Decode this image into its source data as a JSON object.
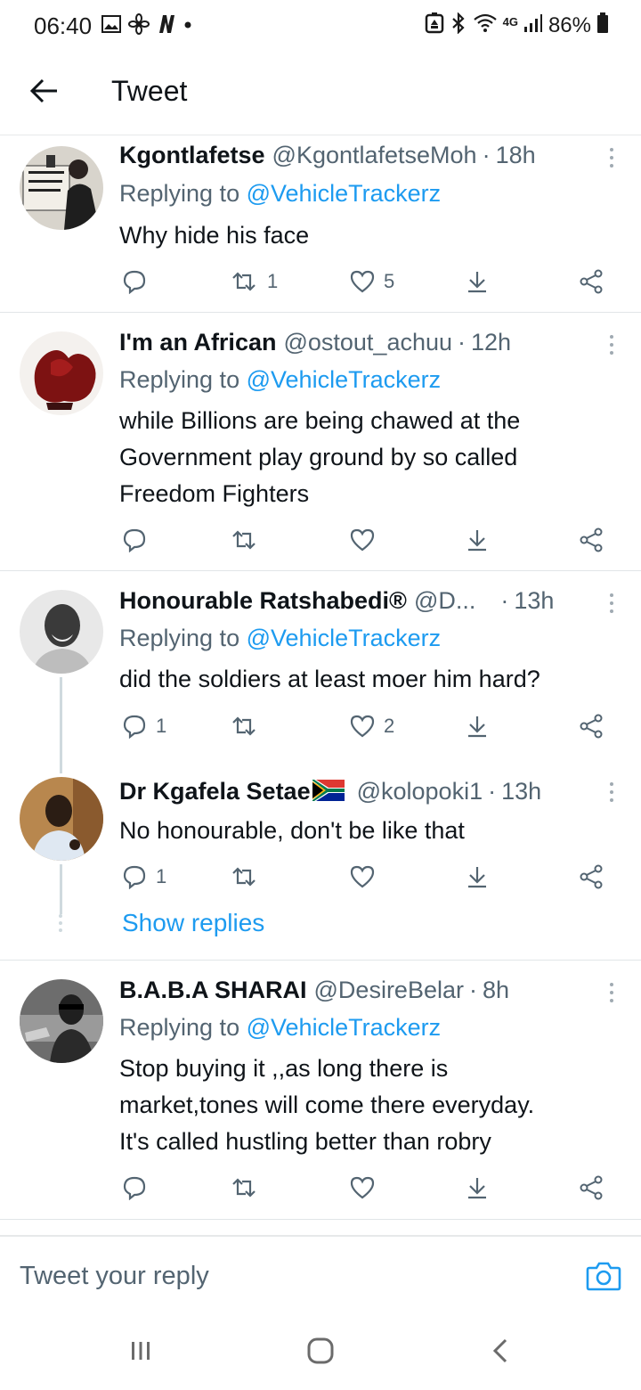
{
  "status_bar": {
    "time": "06:40",
    "battery": "86%",
    "network": "4G",
    "left_icons": [
      "image-icon",
      "fan-icon",
      "netflix-n-icon",
      "dot-icon"
    ],
    "right_icons": [
      "battery-saver-icon",
      "bluetooth-icon",
      "wifi-icon",
      "signal-icon",
      "battery-icon"
    ]
  },
  "header": {
    "title": "Tweet",
    "back_icon": "back-arrow-icon"
  },
  "tweets": [
    {
      "name": "Kgontlafetse",
      "handle": "@KgontlafetseMoh",
      "dot": "·",
      "time": "18h",
      "replying_prefix": "Replying to",
      "replying_to": "@VehicleTrackerz",
      "text": "Why hide his face",
      "reply_count": "",
      "retweet_count": "1",
      "like_count": "5"
    },
    {
      "name": "I'm an African",
      "handle": "@ostout_achuu",
      "dot": "·",
      "time": "12h",
      "replying_prefix": "Replying to",
      "replying_to": "@VehicleTrackerz",
      "text_lines": [
        "while Billions are being chawed at the",
        "Government play ground by so called",
        "Freedom Fighters"
      ],
      "reply_count": "",
      "retweet_count": "",
      "like_count": ""
    },
    {
      "name": "Honourable Ratshabedi®",
      "handle": "@D...",
      "dot": "·",
      "time": "13h",
      "replying_prefix": "Replying to",
      "replying_to": "@VehicleTrackerz",
      "text": "did the soldiers at least moer him hard?",
      "reply_count": "1",
      "retweet_count": "",
      "like_count": "2"
    },
    {
      "name": "Dr Kgafela Setae",
      "flag_emoji": "south-africa-flag-icon",
      "handle": "@kolopoki1",
      "dot": "·",
      "time": "13h",
      "text": "No honourable, don't be like that",
      "reply_count": "1",
      "retweet_count": "",
      "like_count": "",
      "show_replies": "Show replies"
    },
    {
      "name": "B.A.B.A SHARAI",
      "handle": "@DesireBelar",
      "dot": "·",
      "time": "8h",
      "replying_prefix": "Replying to",
      "replying_to": "@VehicleTrackerz",
      "text_lines": [
        "Stop buying it ,,as long there is",
        "market,tones will come there everyday.",
        "It's called hustling better than robry"
      ],
      "reply_count": "",
      "retweet_count": "",
      "like_count": ""
    }
  ],
  "reply_bar": {
    "placeholder": "Tweet your reply",
    "camera_icon": "camera-icon"
  },
  "nav_bar": {
    "icons": [
      "recent-apps-icon",
      "home-icon",
      "back-icon"
    ]
  },
  "colors": {
    "accent": "#1d9bf0",
    "secondary_text": "#536471",
    "primary_text": "#0f1419",
    "divider": "#e1e5e8"
  }
}
